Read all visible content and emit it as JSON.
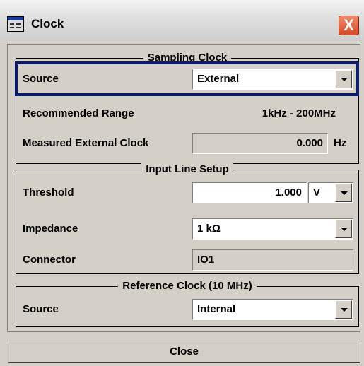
{
  "window": {
    "title": "Clock",
    "close_symbol": "X"
  },
  "sampling_clock": {
    "legend": "Sampling Clock",
    "source_label": "Source",
    "source_value": "External",
    "range_label": "Recommended Range",
    "range_value": "1kHz - 200MHz",
    "measured_label": "Measured External Clock",
    "measured_value": "0.000",
    "measured_unit": "Hz"
  },
  "input_line_setup": {
    "legend": "Input Line Setup",
    "threshold_label": "Threshold",
    "threshold_value": "1.000",
    "threshold_unit": "V",
    "impedance_label": "Impedance",
    "impedance_value": "1 kΩ",
    "connector_label": "Connector",
    "connector_value": "IO1"
  },
  "reference_clock": {
    "legend": "Reference Clock (10 MHz)",
    "source_label": "Source",
    "source_value": "Internal"
  },
  "footer": {
    "close_label": "Close"
  },
  "colors": {
    "dialog_bg": "#d4d0c8",
    "focus_border": "#0a1a6e",
    "close_red": "#d84a24"
  }
}
